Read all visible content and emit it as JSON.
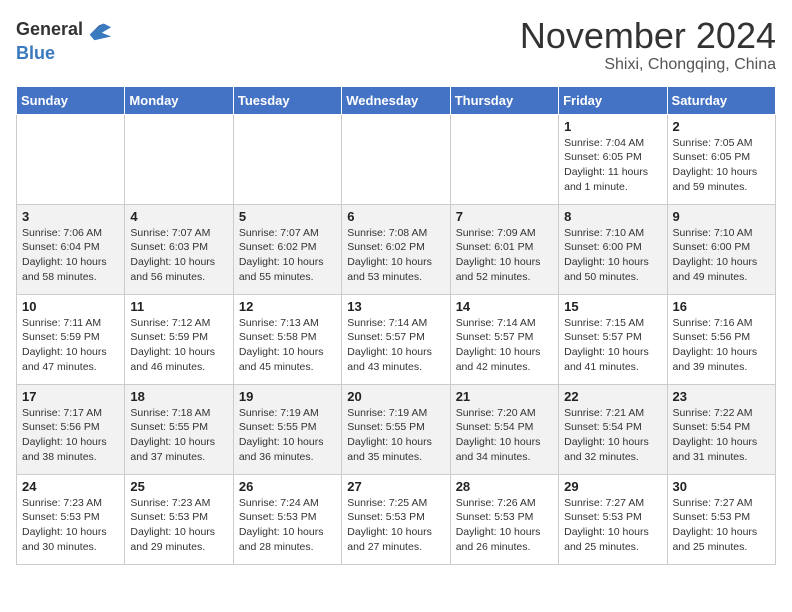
{
  "header": {
    "logo_line1": "General",
    "logo_line2": "Blue",
    "month": "November 2024",
    "location": "Shixi, Chongqing, China"
  },
  "weekdays": [
    "Sunday",
    "Monday",
    "Tuesday",
    "Wednesday",
    "Thursday",
    "Friday",
    "Saturday"
  ],
  "weeks": [
    [
      {
        "day": "",
        "info": ""
      },
      {
        "day": "",
        "info": ""
      },
      {
        "day": "",
        "info": ""
      },
      {
        "day": "",
        "info": ""
      },
      {
        "day": "",
        "info": ""
      },
      {
        "day": "1",
        "info": "Sunrise: 7:04 AM\nSunset: 6:05 PM\nDaylight: 11 hours\nand 1 minute."
      },
      {
        "day": "2",
        "info": "Sunrise: 7:05 AM\nSunset: 6:05 PM\nDaylight: 10 hours\nand 59 minutes."
      }
    ],
    [
      {
        "day": "3",
        "info": "Sunrise: 7:06 AM\nSunset: 6:04 PM\nDaylight: 10 hours\nand 58 minutes."
      },
      {
        "day": "4",
        "info": "Sunrise: 7:07 AM\nSunset: 6:03 PM\nDaylight: 10 hours\nand 56 minutes."
      },
      {
        "day": "5",
        "info": "Sunrise: 7:07 AM\nSunset: 6:02 PM\nDaylight: 10 hours\nand 55 minutes."
      },
      {
        "day": "6",
        "info": "Sunrise: 7:08 AM\nSunset: 6:02 PM\nDaylight: 10 hours\nand 53 minutes."
      },
      {
        "day": "7",
        "info": "Sunrise: 7:09 AM\nSunset: 6:01 PM\nDaylight: 10 hours\nand 52 minutes."
      },
      {
        "day": "8",
        "info": "Sunrise: 7:10 AM\nSunset: 6:00 PM\nDaylight: 10 hours\nand 50 minutes."
      },
      {
        "day": "9",
        "info": "Sunrise: 7:10 AM\nSunset: 6:00 PM\nDaylight: 10 hours\nand 49 minutes."
      }
    ],
    [
      {
        "day": "10",
        "info": "Sunrise: 7:11 AM\nSunset: 5:59 PM\nDaylight: 10 hours\nand 47 minutes."
      },
      {
        "day": "11",
        "info": "Sunrise: 7:12 AM\nSunset: 5:59 PM\nDaylight: 10 hours\nand 46 minutes."
      },
      {
        "day": "12",
        "info": "Sunrise: 7:13 AM\nSunset: 5:58 PM\nDaylight: 10 hours\nand 45 minutes."
      },
      {
        "day": "13",
        "info": "Sunrise: 7:14 AM\nSunset: 5:57 PM\nDaylight: 10 hours\nand 43 minutes."
      },
      {
        "day": "14",
        "info": "Sunrise: 7:14 AM\nSunset: 5:57 PM\nDaylight: 10 hours\nand 42 minutes."
      },
      {
        "day": "15",
        "info": "Sunrise: 7:15 AM\nSunset: 5:57 PM\nDaylight: 10 hours\nand 41 minutes."
      },
      {
        "day": "16",
        "info": "Sunrise: 7:16 AM\nSunset: 5:56 PM\nDaylight: 10 hours\nand 39 minutes."
      }
    ],
    [
      {
        "day": "17",
        "info": "Sunrise: 7:17 AM\nSunset: 5:56 PM\nDaylight: 10 hours\nand 38 minutes."
      },
      {
        "day": "18",
        "info": "Sunrise: 7:18 AM\nSunset: 5:55 PM\nDaylight: 10 hours\nand 37 minutes."
      },
      {
        "day": "19",
        "info": "Sunrise: 7:19 AM\nSunset: 5:55 PM\nDaylight: 10 hours\nand 36 minutes."
      },
      {
        "day": "20",
        "info": "Sunrise: 7:19 AM\nSunset: 5:55 PM\nDaylight: 10 hours\nand 35 minutes."
      },
      {
        "day": "21",
        "info": "Sunrise: 7:20 AM\nSunset: 5:54 PM\nDaylight: 10 hours\nand 34 minutes."
      },
      {
        "day": "22",
        "info": "Sunrise: 7:21 AM\nSunset: 5:54 PM\nDaylight: 10 hours\nand 32 minutes."
      },
      {
        "day": "23",
        "info": "Sunrise: 7:22 AM\nSunset: 5:54 PM\nDaylight: 10 hours\nand 31 minutes."
      }
    ],
    [
      {
        "day": "24",
        "info": "Sunrise: 7:23 AM\nSunset: 5:53 PM\nDaylight: 10 hours\nand 30 minutes."
      },
      {
        "day": "25",
        "info": "Sunrise: 7:23 AM\nSunset: 5:53 PM\nDaylight: 10 hours\nand 29 minutes."
      },
      {
        "day": "26",
        "info": "Sunrise: 7:24 AM\nSunset: 5:53 PM\nDaylight: 10 hours\nand 28 minutes."
      },
      {
        "day": "27",
        "info": "Sunrise: 7:25 AM\nSunset: 5:53 PM\nDaylight: 10 hours\nand 27 minutes."
      },
      {
        "day": "28",
        "info": "Sunrise: 7:26 AM\nSunset: 5:53 PM\nDaylight: 10 hours\nand 26 minutes."
      },
      {
        "day": "29",
        "info": "Sunrise: 7:27 AM\nSunset: 5:53 PM\nDaylight: 10 hours\nand 25 minutes."
      },
      {
        "day": "30",
        "info": "Sunrise: 7:27 AM\nSunset: 5:53 PM\nDaylight: 10 hours\nand 25 minutes."
      }
    ]
  ]
}
